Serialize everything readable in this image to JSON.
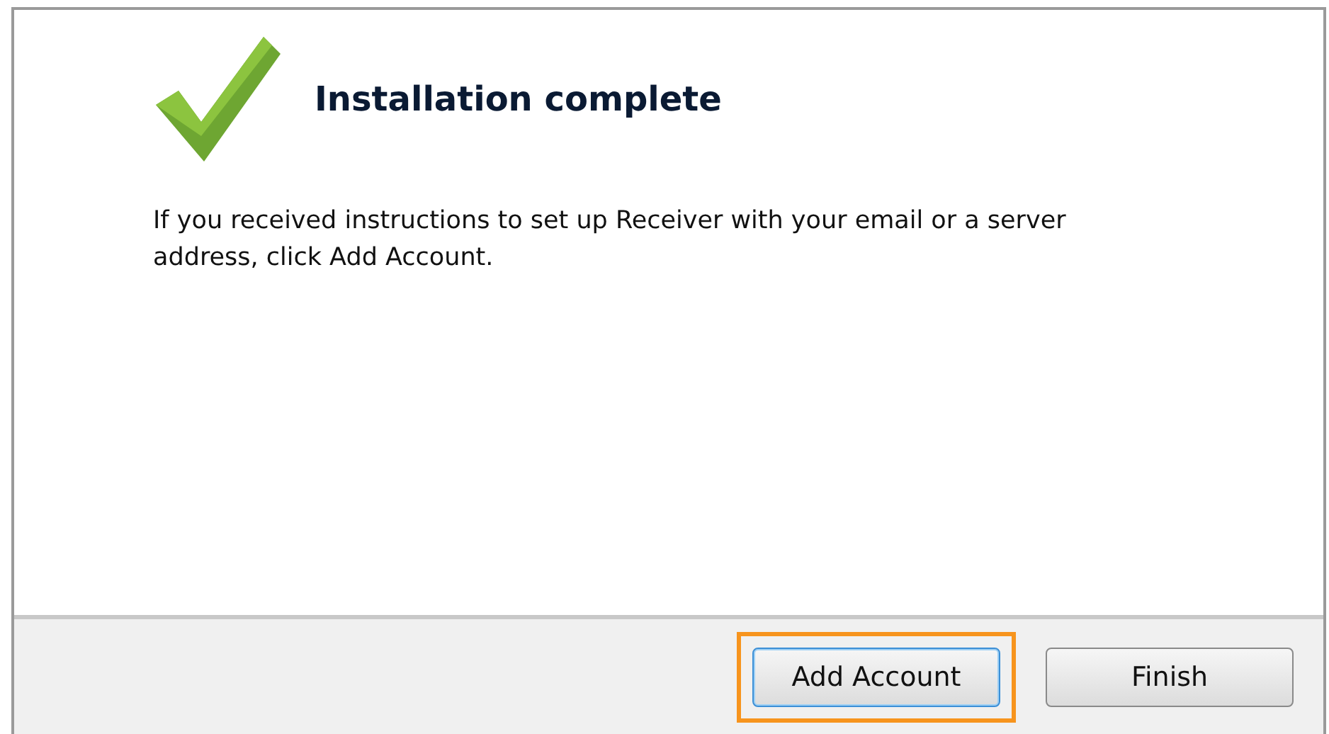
{
  "title": "Installation complete",
  "message": "If you received instructions to set up Receiver with your email or a server address, click Add Account.",
  "buttons": [
    {
      "label": "Add Account",
      "highlighted": true
    },
    {
      "label": "Finish",
      "highlighted": false
    }
  ]
}
